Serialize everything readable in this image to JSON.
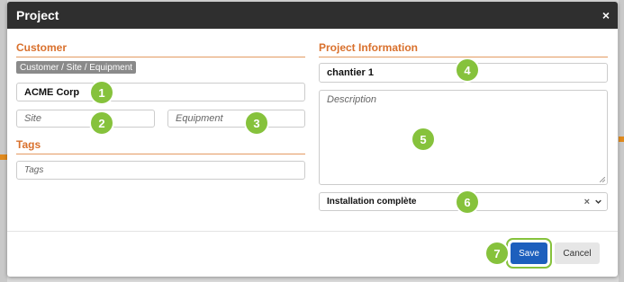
{
  "modal": {
    "title": "Project",
    "close_glyph": "×"
  },
  "customer_section": {
    "title": "Customer",
    "chip_label": "Customer / Site / Equipment",
    "customer_value": "ACME Corp",
    "site_placeholder": "Site",
    "equipment_placeholder": "Equipment"
  },
  "tags_section": {
    "title": "Tags",
    "tags_placeholder": "Tags"
  },
  "project_section": {
    "title": "Project Information",
    "name_value": "chantier 1",
    "description_placeholder": "Description",
    "type_value": "Installation complète",
    "type_clear_glyph": "×"
  },
  "footer": {
    "save_label": "Save",
    "cancel_label": "Cancel"
  },
  "markers": [
    "1",
    "2",
    "3",
    "4",
    "5",
    "6",
    "7"
  ],
  "colors": {
    "header_bg": "#2f2f2f",
    "section_accent": "#d9702c",
    "primary_button": "#1d5fbd",
    "marker": "#86c23c"
  }
}
